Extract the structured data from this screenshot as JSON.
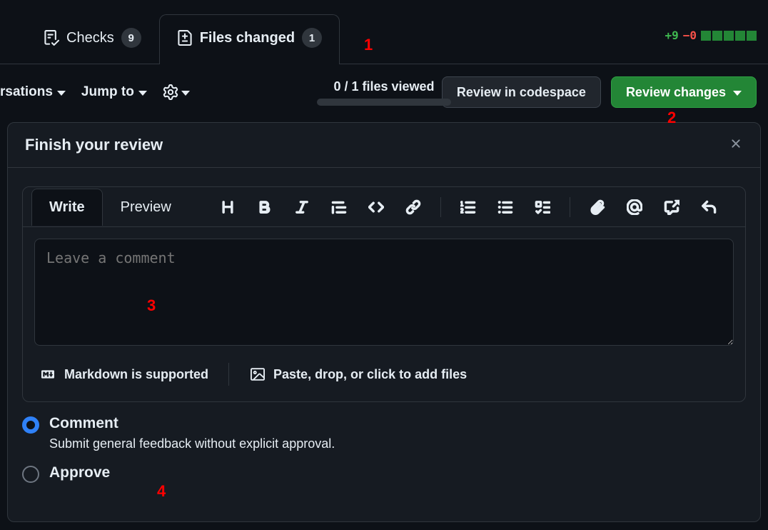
{
  "tabs": {
    "checks": {
      "label": "Checks",
      "count": "9"
    },
    "files_changed": {
      "label": "Files changed",
      "count": "1"
    }
  },
  "diffstat": {
    "additions": "+9",
    "deletions": "−0"
  },
  "toolbar": {
    "conversations": "rsations",
    "jump_to": "Jump to",
    "files_viewed": "0 / 1 files viewed",
    "review_in_codespace": "Review in codespace",
    "review_changes": "Review changes"
  },
  "review": {
    "title": "Finish your review",
    "write_tab": "Write",
    "preview_tab": "Preview",
    "placeholder": "Leave a comment",
    "markdown_supported": "Markdown is supported",
    "paste_files": "Paste, drop, or click to add files",
    "options": {
      "comment": {
        "label": "Comment",
        "desc": "Submit general feedback without explicit approval."
      },
      "approve": {
        "label": "Approve"
      }
    }
  },
  "annotations": {
    "a1": "1",
    "a2": "2",
    "a3": "3",
    "a4": "4"
  }
}
